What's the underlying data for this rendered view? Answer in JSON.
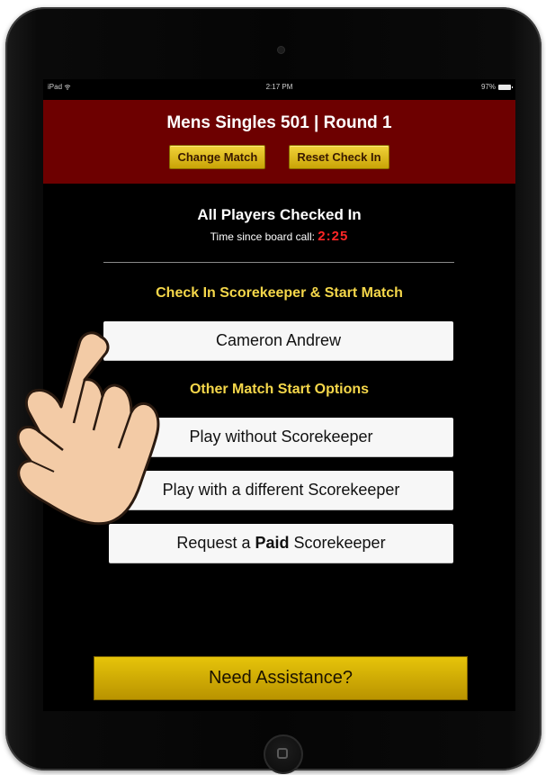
{
  "status_bar": {
    "carrier": "iPad",
    "time": "2:17 PM",
    "battery": "97%"
  },
  "header": {
    "title": "Mens Singles 501 | Round 1",
    "change_match_label": "Change Match",
    "reset_check_in_label": "Reset Check In"
  },
  "checkin": {
    "title": "All Players Checked In",
    "time_since_label": "Time since board call:",
    "timer": "2:25"
  },
  "scorekeeper": {
    "section_title": "Check In Scorekeeper & Start Match",
    "player_name": "Cameron Andrew"
  },
  "other_options": {
    "section_title": "Other Match Start Options",
    "play_without": "Play without Scorekeeper",
    "play_different": "Play with a different Scorekeeper",
    "request_prefix": "Request a ",
    "request_bold": "Paid",
    "request_suffix": " Scorekeeper"
  },
  "assistance": {
    "label": "Need Assistance?"
  },
  "colors": {
    "header_bg": "#6d0000",
    "gold": "#f1d23a",
    "section_title": "#f5d74a",
    "timer": "#ff2626"
  },
  "icons": [
    "wifi-icon",
    "battery-icon",
    "home-button-icon",
    "pointing-hand-icon"
  ]
}
